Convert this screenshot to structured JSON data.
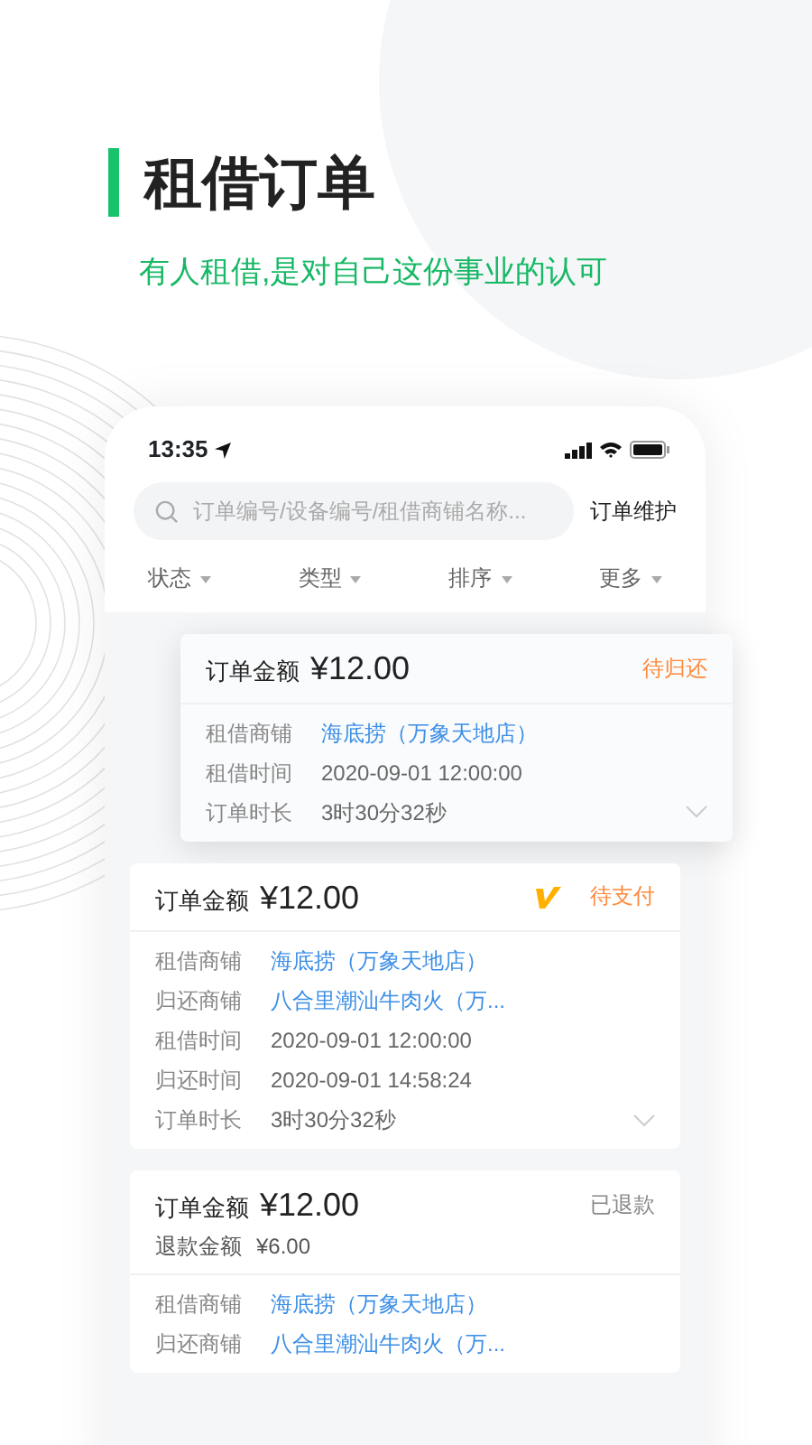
{
  "promo": {
    "title": "租借订单",
    "subtitle": "有人租借,是对自己这份事业的认可"
  },
  "status_bar": {
    "time": "13:35"
  },
  "search": {
    "placeholder": "订单编号/设备编号/租借商铺名称...",
    "action": "订单维护"
  },
  "filters": [
    {
      "label": "状态"
    },
    {
      "label": "类型"
    },
    {
      "label": "排序"
    },
    {
      "label": "更多"
    }
  ],
  "orders": [
    {
      "raised": true,
      "amount_label": "订单金额",
      "amount": "¥12.00",
      "status": "待归还",
      "color": "#ff8a3d",
      "badge": false,
      "fields": [
        {
          "label": "租借商铺",
          "value": "海底捞（万象天地店）",
          "kind": "shop"
        },
        {
          "label": "租借时间",
          "value": "2020-09-01  12:00:00",
          "kind": "text"
        },
        {
          "label": "订单时长",
          "value": "3时30分32秒",
          "kind": "text"
        }
      ]
    },
    {
      "raised": false,
      "amount_label": "订单金额",
      "amount": "¥12.00",
      "status": "待支付",
      "color": "#ff8a3d",
      "badge": true,
      "fields": [
        {
          "label": "租借商铺",
          "value": "海底捞（万象天地店）",
          "kind": "shop"
        },
        {
          "label": "归还商铺",
          "value": "八合里潮汕牛肉火（万...",
          "kind": "shop"
        },
        {
          "label": "租借时间",
          "value": "2020-09-01  12:00:00",
          "kind": "text"
        },
        {
          "label": "归还时间",
          "value": "2020-09-01  14:58:24",
          "kind": "text"
        },
        {
          "label": "订单时长",
          "value": "3时30分32秒",
          "kind": "text"
        }
      ]
    },
    {
      "raised": false,
      "amount_label": "订单金额",
      "amount": "¥12.00",
      "status": "已退款",
      "color": "#888888",
      "badge": false,
      "refund_label": "退款金额",
      "refund": "¥6.00",
      "fields": [
        {
          "label": "租借商铺",
          "value": "海底捞（万象天地店）",
          "kind": "shop"
        },
        {
          "label": "归还商铺",
          "value": "八合里潮汕牛肉火（万...",
          "kind": "shop"
        }
      ]
    }
  ]
}
